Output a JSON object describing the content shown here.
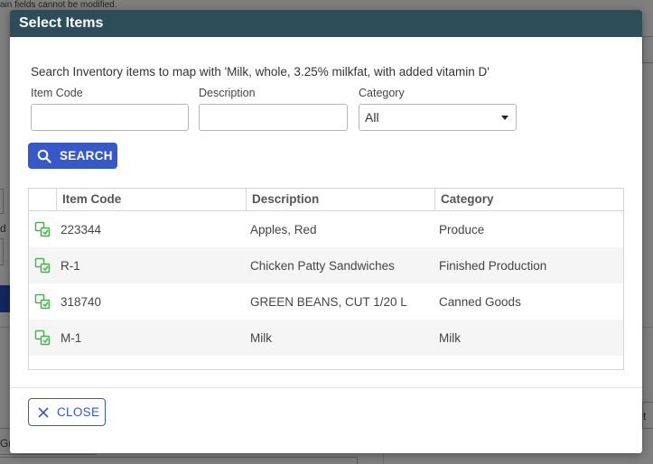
{
  "background": {
    "note": "ain fields cannot be modified.",
    "fragment_d": "d",
    "fragment_t": "t",
    "fragment_gr": "Gr"
  },
  "modal": {
    "title": "Select Items",
    "intro": "Search Inventory items to map with 'Milk, whole, 3.25% milkfat, with added vitamin D'",
    "fields": {
      "item_code_label": "Item Code",
      "item_code_value": "",
      "description_label": "Description",
      "description_value": "",
      "category_label": "Category",
      "category_value": "All"
    },
    "search_label": "SEARCH",
    "close_label": "CLOSE",
    "table": {
      "columns": [
        "",
        "Item Code",
        "Description",
        "Category"
      ],
      "rows": [
        {
          "code": "223344",
          "description": "Apples, Red",
          "category": "Produce"
        },
        {
          "code": "R-1",
          "description": "Chicken Patty Sandwiches",
          "category": "Finished Production"
        },
        {
          "code": "318740",
          "description": "GREEN BEANS, CUT 1/20 L",
          "category": "Canned Goods"
        },
        {
          "code": "M-1",
          "description": "Milk",
          "category": "Milk"
        }
      ]
    }
  },
  "colors": {
    "header_bg": "#2d4e58",
    "accent": "#3658c9",
    "map_icon": "#4caf50"
  },
  "icons": {
    "search": "search-icon",
    "close": "close-icon",
    "row_action": "map-item-icon",
    "dropdown": "chevron-down-icon"
  }
}
